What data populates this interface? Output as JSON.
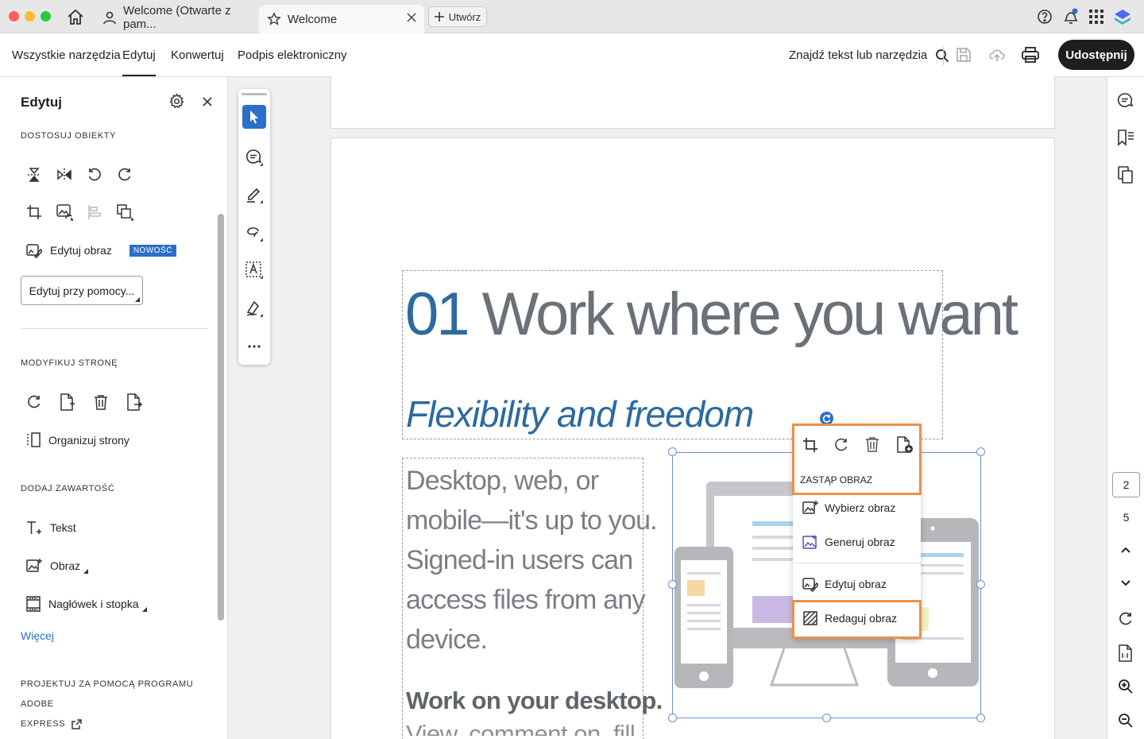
{
  "titlebar": {
    "tabs": [
      {
        "label": "Welcome (Otwarte z pam..."
      },
      {
        "label": "Welcome"
      }
    ],
    "new_tab_label": "Utwórz"
  },
  "menubar": {
    "items": [
      "Wszystkie narzędzia",
      "Edytuj",
      "Konwertuj",
      "Podpis elektroniczny"
    ],
    "active_item": "Edytuj",
    "search_label": "Znajdź tekst lub narzędzia",
    "share_label": "Udostępnij"
  },
  "leftpanel": {
    "title": "Edytuj",
    "section_adjust": "DOSTOSUJ OBIEKTY",
    "edit_image_label": "Edytuj obraz",
    "new_badge": "NOWOŚĆ",
    "edit_with_label": "Edytuj przy pomocy...",
    "section_modify": "MODYFIKUJ STRONĘ",
    "organize_label": "Organizuj strony",
    "section_add": "DODAJ ZAWARTOŚĆ",
    "text_label": "Tekst",
    "image_label": "Obraz",
    "header_footer_label": "Nagłówek i stopka",
    "more_label": "Więcej",
    "section_express_line1": "PROJEKTUJ ZA POMOCĄ PROGRAMU ADOBE",
    "section_express_line2": "EXPRESS"
  },
  "document": {
    "heading_number": "01",
    "heading_text": "Work where you want",
    "subheading": "Flexibility and freedom",
    "body_lines": [
      "Desktop, web, or",
      "mobile—it's up to you.",
      "Signed-in users can",
      "access files from any",
      "device."
    ],
    "bold_line": "Work on your desktop.",
    "cut_line": "View, comment on, fill"
  },
  "context_menu": {
    "section_label": "ZASTĄP OBRAZ",
    "items": [
      "Wybierz obraz",
      "Generuj obraz",
      "Edytuj obraz",
      "Redaguj obraz"
    ]
  },
  "rightrail": {
    "page_current": "2",
    "page_total": "5"
  },
  "colors": {
    "accent_blue": "#2d6ec9",
    "heading_blue": "#2c6aa0",
    "highlight_orange": "#e8924b",
    "share_bg": "#1e1e1e"
  }
}
